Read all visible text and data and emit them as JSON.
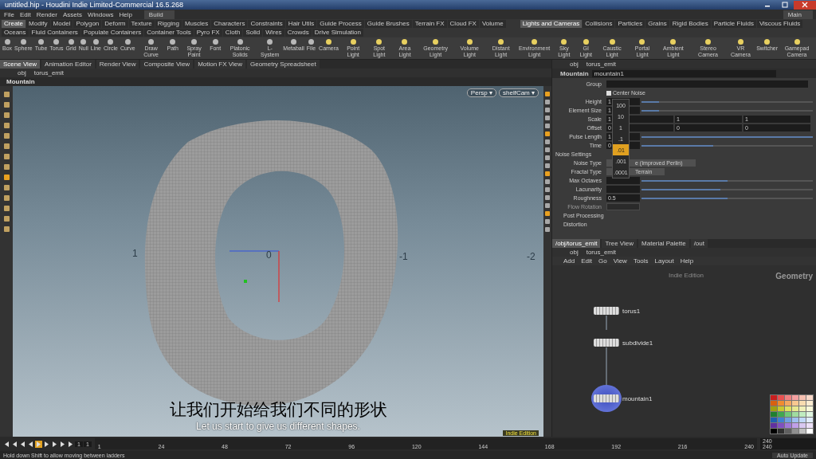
{
  "window": {
    "title": "untitled.hip - Houdini Indie Limited-Commercial 16.5.268"
  },
  "menu": [
    "File",
    "Edit",
    "Render",
    "Assets",
    "Windows",
    "Help"
  ],
  "desktop": "Build",
  "desktop_right": "Main",
  "shelf_tabs_left": [
    {
      "label": "Create",
      "selected": true
    },
    {
      "label": "Modify",
      "selected": false
    },
    {
      "label": "Model",
      "selected": false
    },
    {
      "label": "Polygon",
      "selected": false
    },
    {
      "label": "Deform",
      "selected": false
    },
    {
      "label": "Texture",
      "selected": false
    },
    {
      "label": "Rigging",
      "selected": false
    },
    {
      "label": "Muscles",
      "selected": false
    },
    {
      "label": "Characters",
      "selected": false
    },
    {
      "label": "Constraints",
      "selected": false
    },
    {
      "label": "Hair Utils",
      "selected": false
    },
    {
      "label": "Guide Process",
      "selected": false
    },
    {
      "label": "Guide Brushes",
      "selected": false
    },
    {
      "label": "Terrain FX",
      "selected": false
    },
    {
      "label": "Cloud FX",
      "selected": false
    },
    {
      "label": "Volume",
      "selected": false
    }
  ],
  "shelf_tabs_right": [
    {
      "label": "Lights and Cameras",
      "selected": true
    },
    {
      "label": "Collisions",
      "selected": false
    },
    {
      "label": "Particles",
      "selected": false
    },
    {
      "label": "Grains",
      "selected": false
    },
    {
      "label": "Rigid Bodies",
      "selected": false
    },
    {
      "label": "Particle Fluids",
      "selected": false
    },
    {
      "label": "Viscous Fluids",
      "selected": false
    },
    {
      "label": "Oceans",
      "selected": false
    },
    {
      "label": "Fluid Containers",
      "selected": false
    },
    {
      "label": "Populate Containers",
      "selected": false
    },
    {
      "label": "Container Tools",
      "selected": false
    },
    {
      "label": "Pyro FX",
      "selected": false
    },
    {
      "label": "Cloth",
      "selected": false
    },
    {
      "label": "Solid",
      "selected": false
    },
    {
      "label": "Wires",
      "selected": false
    },
    {
      "label": "Crowds",
      "selected": false
    },
    {
      "label": "Drive Simulation",
      "selected": false
    }
  ],
  "tools_left": [
    "Box",
    "Sphere",
    "Tube",
    "Torus",
    "Grid",
    "Null",
    "Line",
    "Circle",
    "Curve",
    "Draw Curve",
    "Path",
    "Spray Paint",
    "Font",
    "Platonic Solids",
    "L-System",
    "Metaball",
    "File"
  ],
  "tools_right": [
    "Camera",
    "Point Light",
    "Spot Light",
    "Area Light",
    "Geometry Light",
    "Volume Light",
    "Distant Light",
    "Environment Light",
    "Sky Light",
    "GI Light",
    "Caustic Light",
    "Portal Light",
    "Ambient Light",
    "Stereo Camera",
    "VR Camera",
    "Switcher",
    "Gamepad Camera"
  ],
  "pane_tabs": [
    {
      "label": "Scene View",
      "selected": true
    },
    {
      "label": "Animation Editor",
      "selected": false
    },
    {
      "label": "Render View",
      "selected": false
    },
    {
      "label": "Composite View",
      "selected": false
    },
    {
      "label": "Motion FX View",
      "selected": false
    },
    {
      "label": "Geometry Spreadsheet",
      "selected": false
    }
  ],
  "path": [
    "obj",
    "torus_emit"
  ],
  "viewport": {
    "title": "Mountain",
    "view_buttons": [
      "Persp ▾",
      "shelfCam ▾"
    ],
    "axis_labels": [
      "1",
      "0",
      "-1",
      "-2"
    ],
    "edition": "Indie Edition"
  },
  "subtitles": {
    "chinese": "让我们开始给我们不同的形状",
    "english": "Let us start to give us different shapes."
  },
  "params": {
    "path": [
      "obj",
      "torus_emit"
    ],
    "node_type": "Mountain",
    "node_name": "mountain1",
    "rows": [
      {
        "kind": "text",
        "label": "Group"
      },
      {
        "kind": "checkbox",
        "label": "Center Noise",
        "checked": true
      },
      {
        "kind": "slider",
        "label": "Height",
        "value": "1",
        "level": 0.1
      },
      {
        "kind": "slider",
        "label": "Element Size",
        "value": "1",
        "level": 0.1
      },
      {
        "kind": "vector",
        "label": "Scale",
        "values": [
          "1",
          "1",
          "1"
        ]
      },
      {
        "kind": "vector",
        "label": "Offset",
        "values": [
          "0",
          "0",
          "0"
        ]
      },
      {
        "kind": "slider",
        "label": "Pulse Length",
        "value": "1",
        "level": 1
      },
      {
        "kind": "slider",
        "label": "Time",
        "value": "0",
        "level": 0.42
      },
      {
        "kind": "heading",
        "label": "Noise Settings"
      },
      {
        "kind": "menu",
        "label": "Noise Type",
        "value": "e (Improved Perlin)"
      },
      {
        "kind": "menu",
        "label": "Fractal Type",
        "value": "Terrain"
      },
      {
        "kind": "slider",
        "label": "Max Octaves",
        "level": 0.5
      },
      {
        "kind": "slider",
        "label": "Lacunarity",
        "level": 0.46
      },
      {
        "kind": "slider",
        "label": "Roughness",
        "value": "0.5",
        "level": 0.5
      },
      {
        "kind": "disabled",
        "label": "Flow Rotation"
      },
      {
        "kind": "folder",
        "label": "Post Processing"
      },
      {
        "kind": "folder",
        "label": "Distortion"
      }
    ],
    "ladder": [
      {
        "label": "100",
        "selected": false
      },
      {
        "label": "10",
        "selected": false
      },
      {
        "label": "1",
        "selected": false
      },
      {
        "label": ".1",
        "selected": false
      },
      {
        "label": ".01",
        "selected": true
      },
      {
        "label": ".001",
        "selected": false
      },
      {
        "label": ".0001",
        "selected": false
      }
    ]
  },
  "network": {
    "tabs": [
      {
        "label": "/obj/torus_emit",
        "selected": true
      },
      {
        "label": "Tree View",
        "selected": false
      },
      {
        "label": "Material Palette",
        "selected": false
      },
      {
        "label": "/out",
        "selected": false
      }
    ],
    "path": [
      "obj",
      "torus_emit"
    ],
    "menu": [
      "Add",
      "Edit",
      "Go",
      "View",
      "Tools",
      "Layout",
      "Help"
    ],
    "edition": "Indie Edition",
    "context": "Geometry",
    "nodes": [
      {
        "name": "torus1",
        "display": false
      },
      {
        "name": "subdivide1",
        "display": false
      },
      {
        "name": "mountain1",
        "display": true
      }
    ]
  },
  "palette": [
    {
      "color": "#c81e1e"
    },
    {
      "color": "#e85050"
    },
    {
      "color": "#f08080"
    },
    {
      "color": "#f4a0a0"
    },
    {
      "color": "#f6c0b0"
    },
    {
      "color": "#f8d8c8"
    },
    {
      "color": "#d86010"
    },
    {
      "color": "#f08c30"
    },
    {
      "color": "#f4a860"
    },
    {
      "color": "#f8c890"
    },
    {
      "color": "#f8dcb0"
    },
    {
      "color": "#fcecd0"
    },
    {
      "color": "#a0a010"
    },
    {
      "color": "#c8c830"
    },
    {
      "color": "#e0e060"
    },
    {
      "color": "#e8e890"
    },
    {
      "color": "#f0f0b8"
    },
    {
      "color": "#f8f8d8"
    },
    {
      "color": "#208030"
    },
    {
      "color": "#40a850"
    },
    {
      "color": "#70c878"
    },
    {
      "color": "#a0dca0"
    },
    {
      "color": "#c0ecc0"
    },
    {
      "color": "#e0f6e0"
    },
    {
      "color": "#2060b0"
    },
    {
      "color": "#4080d0"
    },
    {
      "color": "#70a0e0"
    },
    {
      "color": "#a0c0f0"
    },
    {
      "color": "#c0d8f8"
    },
    {
      "color": "#e0ecfc"
    },
    {
      "color": "#6030a0"
    },
    {
      "color": "#8050c0"
    },
    {
      "color": "#a078d8"
    },
    {
      "color": "#c0a0e8"
    },
    {
      "color": "#d8c8f0"
    },
    {
      "color": "#ece0f8"
    },
    {
      "color": "#000000"
    },
    {
      "color": "#303030"
    },
    {
      "color": "#606060"
    },
    {
      "color": "#909090"
    },
    {
      "color": "#c0c0c0"
    },
    {
      "color": "#ffffff"
    }
  ],
  "timeline": {
    "frame": "1",
    "start": "1",
    "ticks": [
      "1",
      "24",
      "48",
      "72",
      "96",
      "120",
      "144",
      "168",
      "192",
      "216",
      "240"
    ],
    "end": "240",
    "end2": "240"
  },
  "status_bar": {
    "message": "Hold down Shift to allow moving between ladders",
    "auto_update": "Auto Update"
  }
}
